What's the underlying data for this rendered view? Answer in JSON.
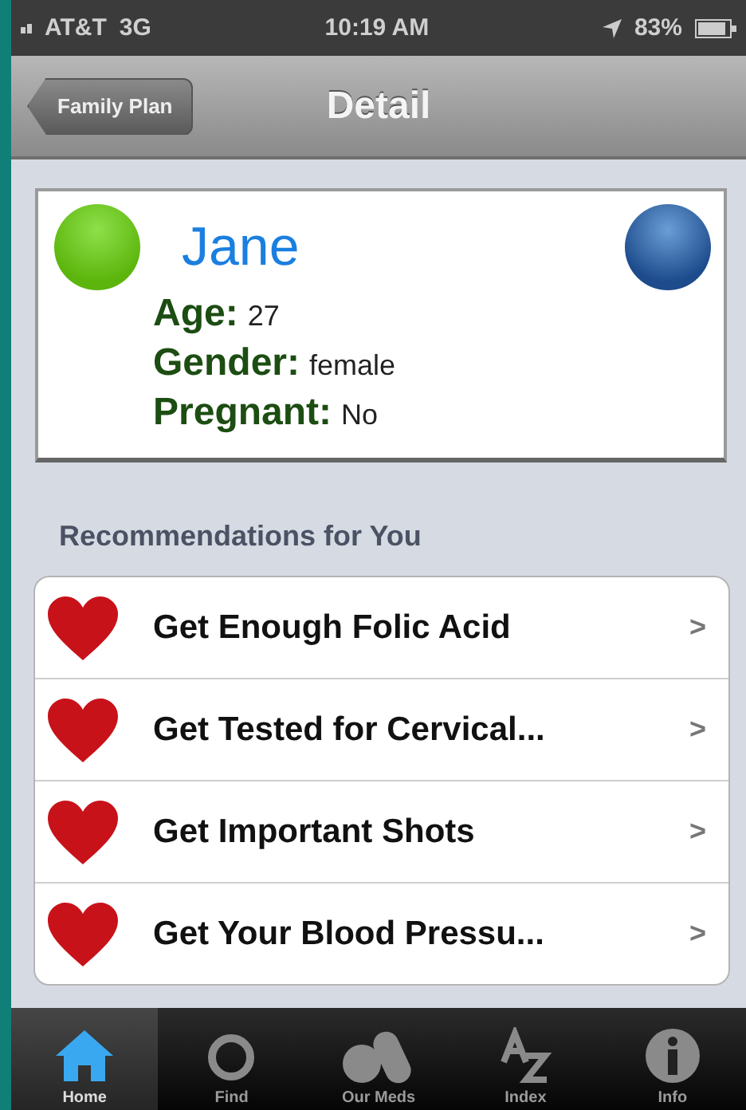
{
  "status_bar": {
    "carrier": "AT&T",
    "network": "3G",
    "time": "10:19 AM",
    "battery": "83%"
  },
  "nav_bar": {
    "back": "Family Plan",
    "title": "Detail"
  },
  "profile": {
    "name": "Jane",
    "fields": [
      {
        "label": "Age:",
        "value": "27"
      },
      {
        "label": "Gender:",
        "value": "female"
      },
      {
        "label": "Pregnant:",
        "value": "No"
      }
    ]
  },
  "section_title": "Recommendations for You",
  "recommendations": [
    {
      "title": "Get Enough Folic Acid"
    },
    {
      "title": "Get Tested for Cervical..."
    },
    {
      "title": "Get Important Shots"
    },
    {
      "title": "Get Your Blood Pressu..."
    }
  ],
  "chevron": ">",
  "tabs": [
    {
      "label": "Home",
      "kind": "home",
      "selected": true
    },
    {
      "label": "Find",
      "kind": "find",
      "selected": false
    },
    {
      "label": "Our Meds",
      "kind": "meds",
      "selected": false
    },
    {
      "label": "Index",
      "kind": "index",
      "selected": false
    },
    {
      "label": "Info",
      "kind": "info",
      "selected": false
    }
  ]
}
